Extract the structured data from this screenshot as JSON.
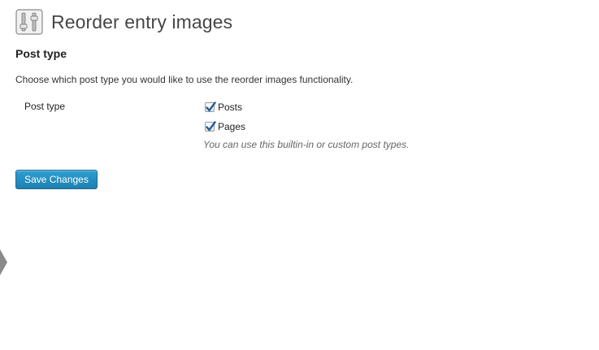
{
  "header": {
    "title": "Reorder entry images",
    "icon": "settings-sliders-icon"
  },
  "section": {
    "title": "Post type",
    "description": "Choose which post type you would like to use the reorder images functionality."
  },
  "form": {
    "field_label": "Post type",
    "options": [
      {
        "label": "Posts",
        "checked": true
      },
      {
        "label": "Pages",
        "checked": true
      }
    ],
    "hint": "You can use this builtin-in or custom post types."
  },
  "actions": {
    "save_label": "Save Changes"
  },
  "colors": {
    "accent": "#2a95c5",
    "check": "#1f5f9e"
  }
}
